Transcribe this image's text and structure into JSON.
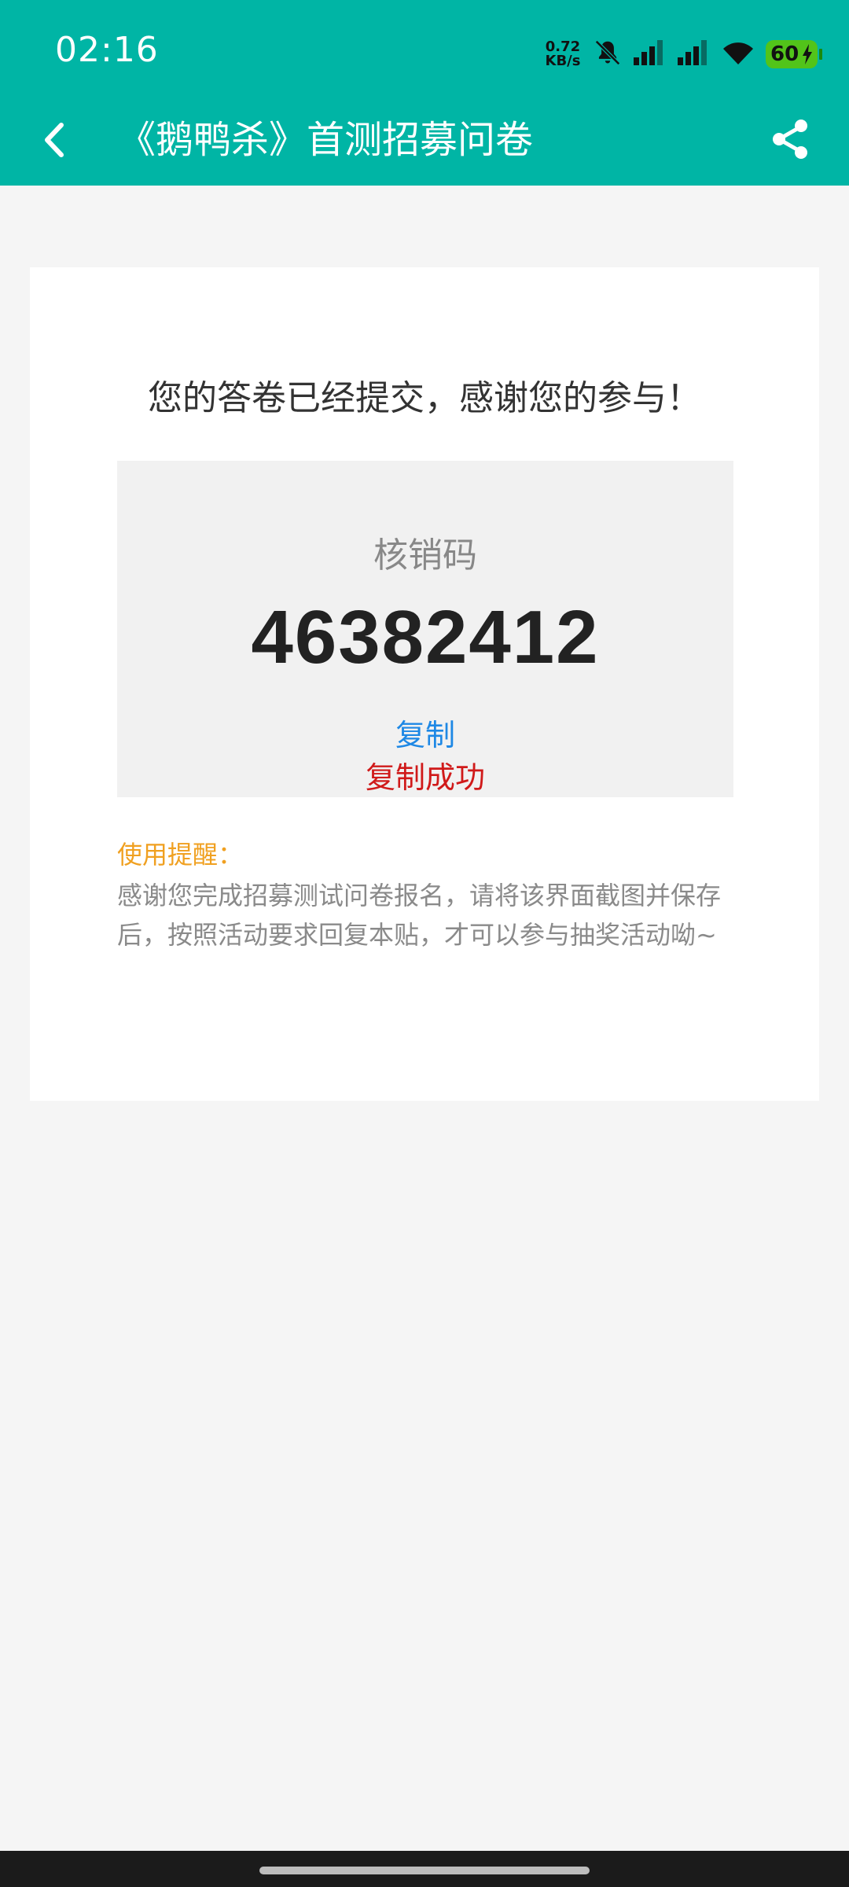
{
  "status_bar": {
    "time": "02:16",
    "net_speed_value": "0.72",
    "net_speed_unit": "KB/s",
    "battery_level": "60",
    "icons": [
      "bell-muted-icon",
      "signal-icon",
      "signal-icon",
      "wifi-icon",
      "battery-icon"
    ]
  },
  "app_bar": {
    "title": "《鹅鸭杀》首测招募问卷",
    "back_icon": "chevron-left-icon",
    "share_icon": "share-icon"
  },
  "card": {
    "success_message": "您的答卷已经提交，感谢您的参与！",
    "code_label": "核销码",
    "code_value": "46382412",
    "copy_label": "复制",
    "copy_success": "复制成功",
    "reminder_title": "使用提醒：",
    "reminder_body": "感谢您完成招募测试问卷报名，请将该界面截图并保存后，按照活动要求回复本贴，才可以参与抽奖活动呦~"
  },
  "colors": {
    "accent": "#00b5a5",
    "link": "#1e88e5",
    "error_red": "#d01a1a",
    "warning_orange": "#f0a020"
  }
}
